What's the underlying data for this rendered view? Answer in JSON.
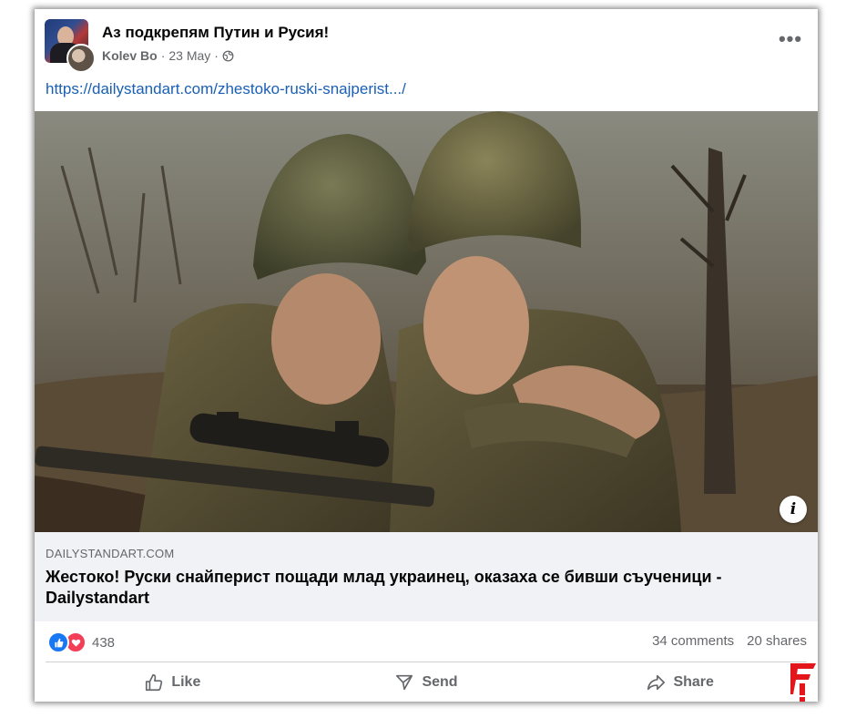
{
  "post": {
    "group_name": "Аз подкрепям Путин и Русия!",
    "author": "Kolev Bo",
    "date": "23 May",
    "separator": "·",
    "more_label": "•••",
    "link_text": "https://dailystandart.com/zhestoko-ruski-snajperist.../"
  },
  "preview": {
    "domain": "DAILYSTANDART.COM",
    "headline": "Жестоко! Руски снайперист пощади млад украинец, оказаха се бивши съученици - Dailystandart",
    "info_label": "i"
  },
  "stats": {
    "reaction_count": "438",
    "comments": "34 comments",
    "shares": "20 shares",
    "reaction_icons": [
      "like-icon",
      "love-icon"
    ]
  },
  "actions": {
    "like": "Like",
    "send": "Send",
    "share": "Share"
  },
  "colors": {
    "link": "#1a5fb4",
    "like_blue": "#1877f2",
    "love_red": "#f33e58",
    "watermark_red": "#e3161b",
    "secondary_text": "#65676b"
  }
}
